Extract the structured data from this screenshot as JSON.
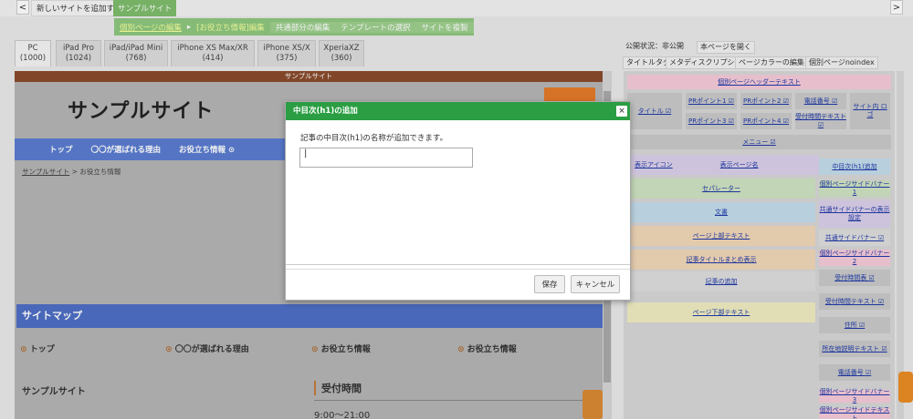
{
  "topbar": {
    "add_site": "新しいサイトを追加する",
    "site_name": "サンプルサイト",
    "left_arrow": "<",
    "right_arrow": ">"
  },
  "green_menu": [
    "個別ページの編集",
    "▸",
    "[お役立ち情報]編集",
    "共通部分の編集",
    "テンプレートの選択",
    "サイトを複製"
  ],
  "devices": [
    {
      "name": "PC",
      "width": "(1000)"
    },
    {
      "name": "iPad Pro",
      "width": "(1024)"
    },
    {
      "name": "iPad/iPad Mini",
      "width": "(768)"
    },
    {
      "name": "iPhone XS Max/XR",
      "width": "(414)"
    },
    {
      "name": "iPhone XS/X",
      "width": "(375)"
    },
    {
      "name": "XperiaXZ",
      "width": "(360)"
    }
  ],
  "preview": {
    "top_bar": "サンプルサイト",
    "title": "サンプルサイト",
    "nav": [
      "トップ",
      "〇〇が選ばれる理由",
      "お役立ち情報 ⊙"
    ],
    "breadcrumb_home": "サンプルサイト",
    "breadcrumb_sep": " > ",
    "breadcrumb_current": "お役立ち情報",
    "sitemap_title": "サイトマップ",
    "sitemap_links": [
      "トップ",
      "〇〇が選ばれる理由",
      "お役立ち情報",
      "お役立ち情報"
    ],
    "footer_name": "サンプルサイト",
    "hours_title": "受付時間",
    "hours_value": "9:00〜21:00"
  },
  "right_panel": {
    "status": "公開状況：非公開",
    "open_page": "本ページを開く",
    "tabs": [
      "タイトルタグ",
      "メタディスクリプション",
      "ページカラーの編集",
      "個別ページnoindex"
    ],
    "blocks": {
      "header_text": "個別ページヘッダーテキスト",
      "title": "タイトル ☑",
      "point1": "PRポイント1 ☑",
      "point2": "PRポイント2 ☑",
      "phone": "電話番号 ☑",
      "side_btn": "サイト内 ロゴ",
      "point3": "PRポイント3 ☑",
      "point4": "PRポイント4 ☑",
      "reception": "受付時間テキスト ☑",
      "menu": "メニュー ☑",
      "display_icon": "表示アイコン",
      "display_page": "表示ページ名",
      "add_h1": "中目次(h1)追加",
      "separator": "セパレーター",
      "side_banner1": "個別ページサイドバナー1",
      "body_text": "文書",
      "common_banner": "共通サイドバナーの表示設定",
      "common_banner2": "共通サイドバナー ☑",
      "page_top_text": "ページ上部テキスト",
      "article_title": "記事タイトルまとめ表示",
      "side_banner2": "個別ページサイドバナー2",
      "article_add": "記事の追加",
      "reception_time": "受付時間表 ☑",
      "reception_text": "受付時間テキスト ☑",
      "page_bottom_text": "ページ下部テキスト",
      "address": "住所 ☑",
      "company_text": "所在地説明テキスト ☑",
      "phone2": "電話番号 ☑",
      "side_banner3": "個別ページサイドバナー3",
      "side_text": "個別ページサイドテキスト"
    }
  },
  "dialog": {
    "title": "中目次(h1)の追加",
    "close": "×",
    "message": "記事の中目次(h1)の名称が追加できます。",
    "input_value": "|",
    "save": "保存",
    "cancel": "キャンセル"
  }
}
